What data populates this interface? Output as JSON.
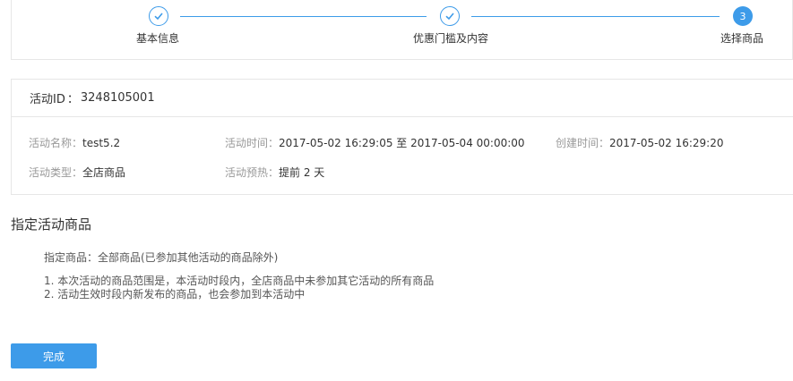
{
  "steps": [
    {
      "label": "基本信息",
      "status": "done"
    },
    {
      "label": "优惠门槛及内容",
      "status": "done"
    },
    {
      "label": "选择商品",
      "status": "active",
      "number": "3"
    }
  ],
  "activity": {
    "id_label": "活动ID",
    "id_sep": "：",
    "id_value": "3248105001",
    "name_label": "活动名称：",
    "name_value": "test5.2",
    "time_label": "活动时间：",
    "time_value": "2017-05-02 16:29:05 至 2017-05-04 00:00:00",
    "created_label": "创建时间：",
    "created_value": "2017-05-02 16:29:20",
    "type_label": "活动类型：",
    "type_value": "全店商品",
    "preheat_label": "活动预热：",
    "preheat_value": "提前 2 天"
  },
  "goods": {
    "title": "指定活动商品",
    "assigned": "指定商品：全部商品(已参加其他活动的商品除外)",
    "notes": [
      "1. 本次活动的商品范围是，本活动时段内，全店商品中未参加其它活动的所有商品",
      "2. 活动生效时段内新发布的商品，也会参加到本活动中"
    ]
  },
  "buttons": {
    "done_label": "完成"
  },
  "colors": {
    "accent": "#3d9be9",
    "border": "#e6e6e6",
    "label_gray": "#999999"
  }
}
